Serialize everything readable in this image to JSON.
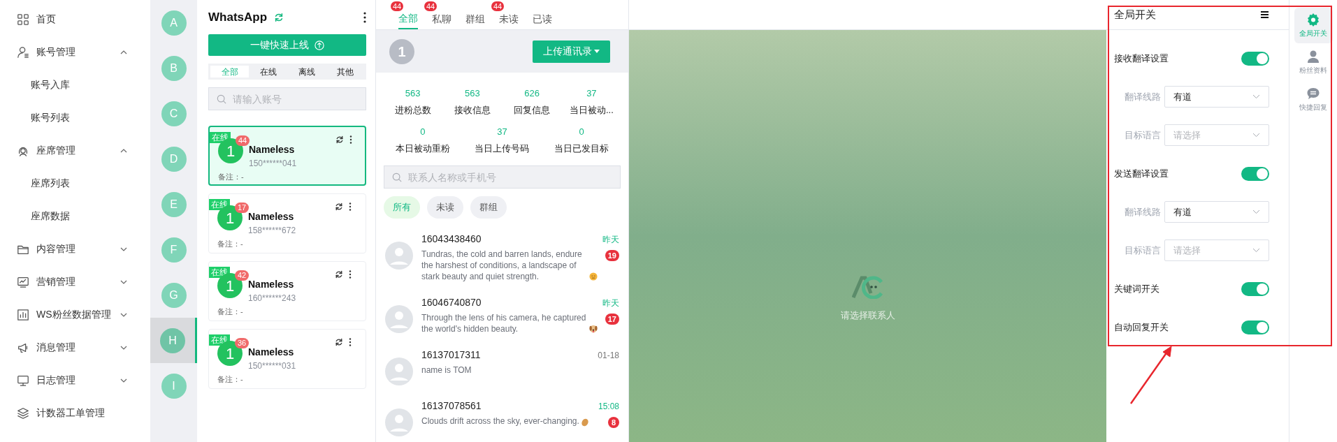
{
  "sidebar": {
    "items": [
      {
        "kind": "link",
        "label": "首页"
      },
      {
        "kind": "group",
        "label": "账号管理",
        "expanded": true,
        "children": [
          {
            "label": "账号入库"
          },
          {
            "label": "账号列表"
          }
        ]
      },
      {
        "kind": "group",
        "label": "座席管理",
        "expanded": true,
        "children": [
          {
            "label": "座席列表"
          },
          {
            "label": "座席数据"
          }
        ]
      },
      {
        "kind": "group",
        "label": "内容管理",
        "expanded": false
      },
      {
        "kind": "group",
        "label": "营销管理",
        "expanded": false
      },
      {
        "kind": "group",
        "label": "WS粉丝数据管理",
        "expanded": false
      },
      {
        "kind": "group",
        "label": "消息管理",
        "expanded": false
      },
      {
        "kind": "group",
        "label": "日志管理",
        "expanded": false
      },
      {
        "kind": "link",
        "label": "计数器工单管理"
      }
    ]
  },
  "letters": [
    {
      "label": "A",
      "selected": false
    },
    {
      "label": "B",
      "selected": false
    },
    {
      "label": "C",
      "selected": false
    },
    {
      "label": "D",
      "selected": false
    },
    {
      "label": "E",
      "selected": false
    },
    {
      "label": "F",
      "selected": false
    },
    {
      "label": "G",
      "selected": false
    },
    {
      "label": "H",
      "selected": true
    },
    {
      "label": "I",
      "selected": false
    }
  ],
  "accounts": {
    "title": "WhatsApp",
    "quick_button": "一键快速上线",
    "filters": [
      {
        "label": "全部",
        "selected": true
      },
      {
        "label": "在线",
        "selected": false
      },
      {
        "label": "离线",
        "selected": false
      },
      {
        "label": "其他",
        "selected": false
      }
    ],
    "search": {
      "placeholder": "请输入账号"
    },
    "cards": [
      {
        "status": "在线",
        "count": "44",
        "avatar": "1",
        "name": "Nameless",
        "phone": "150******041",
        "note": "备注：-",
        "selected": true
      },
      {
        "status": "在线",
        "count": "17",
        "avatar": "1",
        "name": "Nameless",
        "phone": "158******672",
        "note": "备注：-",
        "selected": false
      },
      {
        "status": "在线",
        "count": "42",
        "avatar": "1",
        "name": "Nameless",
        "phone": "160******243",
        "note": "备注：-",
        "selected": false
      },
      {
        "status": "在线",
        "count": "36",
        "avatar": "1",
        "name": "Nameless",
        "phone": "150******031",
        "note": "备注：-",
        "selected": false
      }
    ]
  },
  "chat_tabs": [
    {
      "label": "全部",
      "badge": "44",
      "selected": true
    },
    {
      "label": "私聊",
      "badge": "44",
      "selected": false
    },
    {
      "label": "群组",
      "selected": false
    },
    {
      "label": "未读",
      "badge": "44",
      "selected": false
    },
    {
      "label": "已读",
      "selected": false
    }
  ],
  "profile": {
    "avatar": "1",
    "upload_button": "上传通讯录"
  },
  "stats_row_1": [
    {
      "value": "563",
      "label": "进粉总数"
    },
    {
      "value": "563",
      "label": "接收信息"
    },
    {
      "value": "626",
      "label": "回复信息"
    },
    {
      "value": "37",
      "label": "当日被动..."
    }
  ],
  "stats_row_2": [
    {
      "value": "0",
      "label": "本日被动重粉"
    },
    {
      "value": "37",
      "label": "当日上传号码"
    },
    {
      "value": "0",
      "label": "当日已发目标"
    }
  ],
  "contact_search": {
    "placeholder": "联系人名称或手机号"
  },
  "chips": [
    {
      "label": "所有",
      "selected": true
    },
    {
      "label": "未读",
      "selected": false
    },
    {
      "label": "群组",
      "selected": false
    }
  ],
  "conversations": [
    {
      "name": "16043438460",
      "message": "Tundras, the cold and barren lands, endure the harshest of conditions, a landscape of stark beauty and quiet strength.",
      "time": "昨天",
      "recent": true,
      "unread": "19"
    },
    {
      "name": "16046740870",
      "message": "Through the lens of his camera, he captured the world's hidden beauty.",
      "time": "昨天",
      "recent": true,
      "unread": "17"
    },
    {
      "name": "16137017311",
      "message": "name is TOM",
      "time": "01-18",
      "recent": false
    },
    {
      "name": "16137078561",
      "message": "Clouds drift across the sky, ever-changing.",
      "time": "15:08",
      "recent": true,
      "unread": "8"
    }
  ],
  "chat_area": {
    "empty_text": "请选择联系人"
  },
  "settings": {
    "title": "全局开关",
    "rows": [
      {
        "kind": "toggle",
        "label": "接收翻译设置",
        "on": true
      },
      {
        "kind": "select",
        "label": "翻译线路",
        "value": "有道"
      },
      {
        "kind": "select",
        "label": "目标语言",
        "placeholder": "请选择"
      },
      {
        "kind": "toggle",
        "label": "发送翻译设置",
        "on": true
      },
      {
        "kind": "select",
        "label": "翻译线路",
        "value": "有道"
      },
      {
        "kind": "select",
        "label": "目标语言",
        "placeholder": "请选择"
      },
      {
        "kind": "toggle",
        "label": "关键词开关",
        "on": true
      },
      {
        "kind": "toggle",
        "label": "自动回复开关",
        "on": true
      }
    ]
  },
  "side_tabs": [
    {
      "label": "全局开关",
      "selected": true
    },
    {
      "label": "粉丝资料",
      "selected": false
    },
    {
      "label": "快捷回复",
      "selected": false
    }
  ]
}
